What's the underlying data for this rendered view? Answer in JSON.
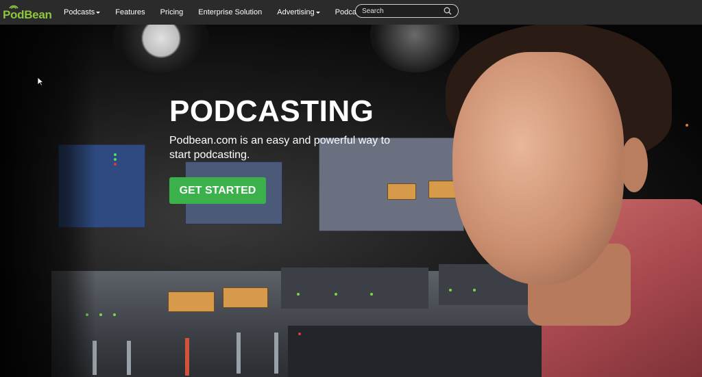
{
  "nav": {
    "logo_text": "PodBean",
    "items": [
      {
        "label": "Podcasts",
        "has_dropdown": true
      },
      {
        "label": "Features",
        "has_dropdown": false
      },
      {
        "label": "Pricing",
        "has_dropdown": false
      },
      {
        "label": "Enterprise Solution",
        "has_dropdown": false
      },
      {
        "label": "Advertising",
        "has_dropdown": true
      },
      {
        "label": "Podcast App",
        "has_dropdown": false
      }
    ],
    "search_placeholder": "Search",
    "search_icon": "search-icon"
  },
  "hero": {
    "headline": "PODCASTING",
    "subtext": "Podbean.com is an easy and powerful way to start podcasting.",
    "cta_label": "GET STARTED"
  },
  "colors": {
    "nav_bg": "#2b2b2b",
    "brand_green": "#8dc63f",
    "cta_green": "#3ab14a"
  }
}
